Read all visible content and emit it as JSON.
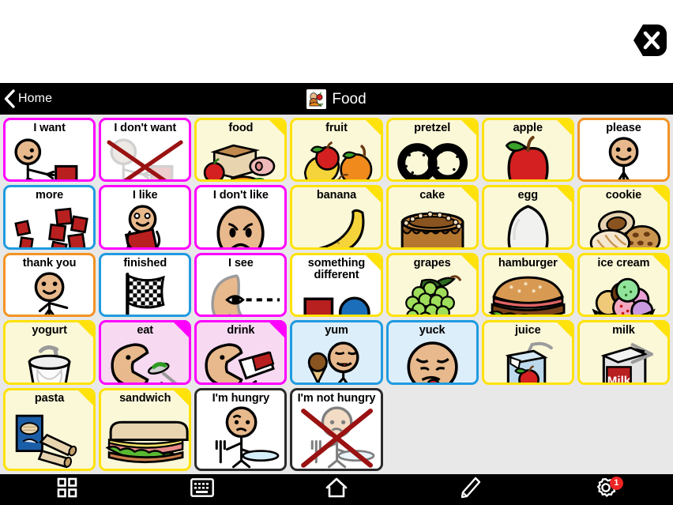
{
  "window": {
    "close_label": "close-button"
  },
  "header": {
    "back_label": "Home",
    "title": "Food",
    "title_icon": "food-basket-icon",
    "background": "#000000",
    "text_color": "#ffffff"
  },
  "palette": {
    "magenta": "#ff00ff",
    "yellow": "#ffe20a",
    "orange": "#f39323",
    "blue": "#1f9be0",
    "black": "#2a2a2a",
    "cream": "#fbf8d8",
    "pink_fill": "#f7d9f2",
    "lightblue_fill": "#ddeefb",
    "grid_bg": "#e8e8e8",
    "badge_red": "#ef2424"
  },
  "grid": {
    "columns": 7,
    "rows": 4,
    "cells": [
      {
        "label": "I want",
        "icon": "person-reaching-icon",
        "border": "#ff00ff",
        "fill": "#ffffff",
        "corner": "none"
      },
      {
        "label": "I don't want",
        "icon": "person-reaching-crossed-icon",
        "border": "#ff00ff",
        "fill": "#ffffff",
        "corner": "none"
      },
      {
        "label": "food",
        "icon": "assorted-food-icon",
        "border": "#ffe20a",
        "fill": "#fbf8d8",
        "corner": "yellow"
      },
      {
        "label": "fruit",
        "icon": "mixed-fruit-icon",
        "border": "#ffe20a",
        "fill": "#fbf8d8",
        "corner": "yellow"
      },
      {
        "label": "pretzel",
        "icon": "pretzel-icon",
        "border": "#ffe20a",
        "fill": "#fbf8d8",
        "corner": "yellow"
      },
      {
        "label": "apple",
        "icon": "apple-icon",
        "border": "#ffe20a",
        "fill": "#fbf8d8",
        "corner": "yellow"
      },
      {
        "label": "please",
        "icon": "person-please-icon",
        "border": "#f39323",
        "fill": "#ffffff",
        "corner": "none"
      },
      {
        "label": "more",
        "icon": "more-blocks-icon",
        "border": "#1f9be0",
        "fill": "#ffffff",
        "corner": "none"
      },
      {
        "label": "I like",
        "icon": "person-hugging-icon",
        "border": "#ff00ff",
        "fill": "#ffffff",
        "corner": "none"
      },
      {
        "label": "I don't like",
        "icon": "sad-face-icon",
        "border": "#ff00ff",
        "fill": "#ffffff",
        "corner": "none"
      },
      {
        "label": "banana",
        "icon": "banana-icon",
        "border": "#ffe20a",
        "fill": "#fbf8d8",
        "corner": "yellow"
      },
      {
        "label": "cake",
        "icon": "cake-icon",
        "border": "#ffe20a",
        "fill": "#fbf8d8",
        "corner": "yellow"
      },
      {
        "label": "egg",
        "icon": "egg-icon",
        "border": "#ffe20a",
        "fill": "#fbf8d8",
        "corner": "yellow"
      },
      {
        "label": "cookie",
        "icon": "cookies-icon",
        "border": "#ffe20a",
        "fill": "#fbf8d8",
        "corner": "yellow"
      },
      {
        "label": "thank you",
        "icon": "person-thank-you-icon",
        "border": "#f39323",
        "fill": "#ffffff",
        "corner": "none"
      },
      {
        "label": "finished",
        "icon": "checkered-flag-icon",
        "border": "#1f9be0",
        "fill": "#ffffff",
        "corner": "none"
      },
      {
        "label": "I see",
        "icon": "eye-looking-icon",
        "border": "#ff00ff",
        "fill": "#ffffff",
        "corner": "none"
      },
      {
        "label": "something different",
        "icon": "square-circle-icon",
        "border": "#ffe20a",
        "fill": "#ffffff",
        "corner": "yellow"
      },
      {
        "label": "grapes",
        "icon": "grapes-icon",
        "border": "#ffe20a",
        "fill": "#fbf8d8",
        "corner": "yellow"
      },
      {
        "label": "hamburger",
        "icon": "hamburger-icon",
        "border": "#ffe20a",
        "fill": "#fbf8d8",
        "corner": "yellow"
      },
      {
        "label": "ice cream",
        "icon": "ice-cream-bowl-icon",
        "border": "#ffe20a",
        "fill": "#fbf8d8",
        "corner": "yellow"
      },
      {
        "label": "yogurt",
        "icon": "yogurt-cup-icon",
        "border": "#ffe20a",
        "fill": "#fbf8d8",
        "corner": "yellow"
      },
      {
        "label": "eat",
        "icon": "person-eating-icon",
        "border": "#ff00ff",
        "fill": "#f7d9f2",
        "corner": "magenta"
      },
      {
        "label": "drink",
        "icon": "person-drinking-icon",
        "border": "#ff00ff",
        "fill": "#f7d9f2",
        "corner": "magenta"
      },
      {
        "label": "yum",
        "icon": "person-ice-cream-yum-icon",
        "border": "#1f9be0",
        "fill": "#ddeefb",
        "corner": "none"
      },
      {
        "label": "yuck",
        "icon": "disgusted-face-icon",
        "border": "#1f9be0",
        "fill": "#ddeefb",
        "corner": "none"
      },
      {
        "label": "juice",
        "icon": "juice-box-icon",
        "border": "#ffe20a",
        "fill": "#fbf8d8",
        "corner": "yellow"
      },
      {
        "label": "milk",
        "icon": "milk-carton-icon",
        "border": "#ffe20a",
        "fill": "#fbf8d8",
        "corner": "yellow"
      },
      {
        "label": "pasta",
        "icon": "pasta-icon",
        "border": "#ffe20a",
        "fill": "#fbf8d8",
        "corner": "yellow"
      },
      {
        "label": "sandwich",
        "icon": "sandwich-icon",
        "border": "#ffe20a",
        "fill": "#fbf8d8",
        "corner": "yellow"
      },
      {
        "label": "I'm hungry",
        "icon": "person-hungry-icon",
        "border": "#2a2a2a",
        "fill": "#ffffff",
        "corner": "none"
      },
      {
        "label": "I'm not hungry",
        "icon": "person-hungry-crossed-icon",
        "border": "#2a2a2a",
        "fill": "#ffffff",
        "corner": "none"
      }
    ]
  },
  "toolbar": {
    "items": [
      {
        "icon": "grid-view-icon",
        "name": "grid-view-button",
        "badge": null
      },
      {
        "icon": "keyboard-icon",
        "name": "keyboard-button",
        "badge": null
      },
      {
        "icon": "home-icon",
        "name": "home-button",
        "badge": null
      },
      {
        "icon": "pencil-icon",
        "name": "edit-button",
        "badge": null
      },
      {
        "icon": "gear-icon",
        "name": "settings-button",
        "badge": "1"
      }
    ]
  }
}
